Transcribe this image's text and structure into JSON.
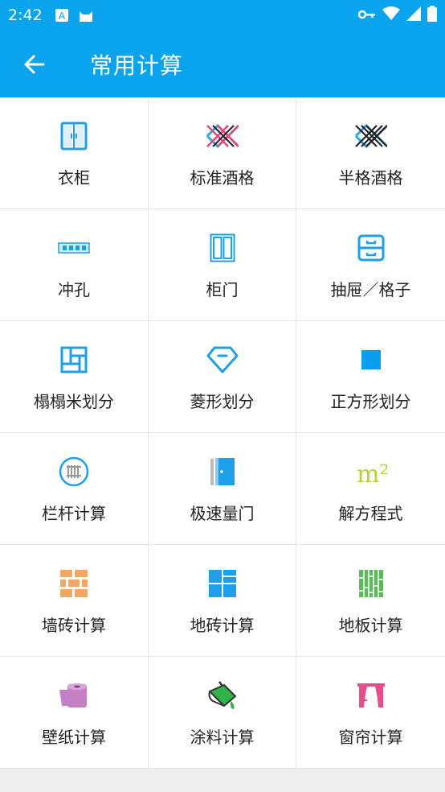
{
  "status": {
    "time": "2:42"
  },
  "appbar": {
    "title": "常用计算"
  },
  "items": [
    {
      "label": "衣柜"
    },
    {
      "label": "标准酒格"
    },
    {
      "label": "半格酒格"
    },
    {
      "label": "冲孔"
    },
    {
      "label": "柜门"
    },
    {
      "label": "抽屉／格子"
    },
    {
      "label": "榻榻米划分"
    },
    {
      "label": "菱形划分"
    },
    {
      "label": "正方形划分"
    },
    {
      "label": "栏杆计算"
    },
    {
      "label": "极速量门"
    },
    {
      "label": "解方程式"
    },
    {
      "label": "墙砖计算"
    },
    {
      "label": "地砖计算"
    },
    {
      "label": "地板计算"
    },
    {
      "label": "壁纸计算"
    },
    {
      "label": "涂料计算"
    },
    {
      "label": "窗帘计算"
    }
  ],
  "m2_symbol": "m²",
  "colors": {
    "primary": "#0aa3ee",
    "blue_icon": "#1e9fe8",
    "tile_orange": "#f0a868",
    "floor_green": "#5cba5c",
    "paint_green": "#2fb34a",
    "paper_purple": "#c57fc4",
    "curtain_pink": "#e54e8a",
    "equation_lime": "#b5d336"
  }
}
